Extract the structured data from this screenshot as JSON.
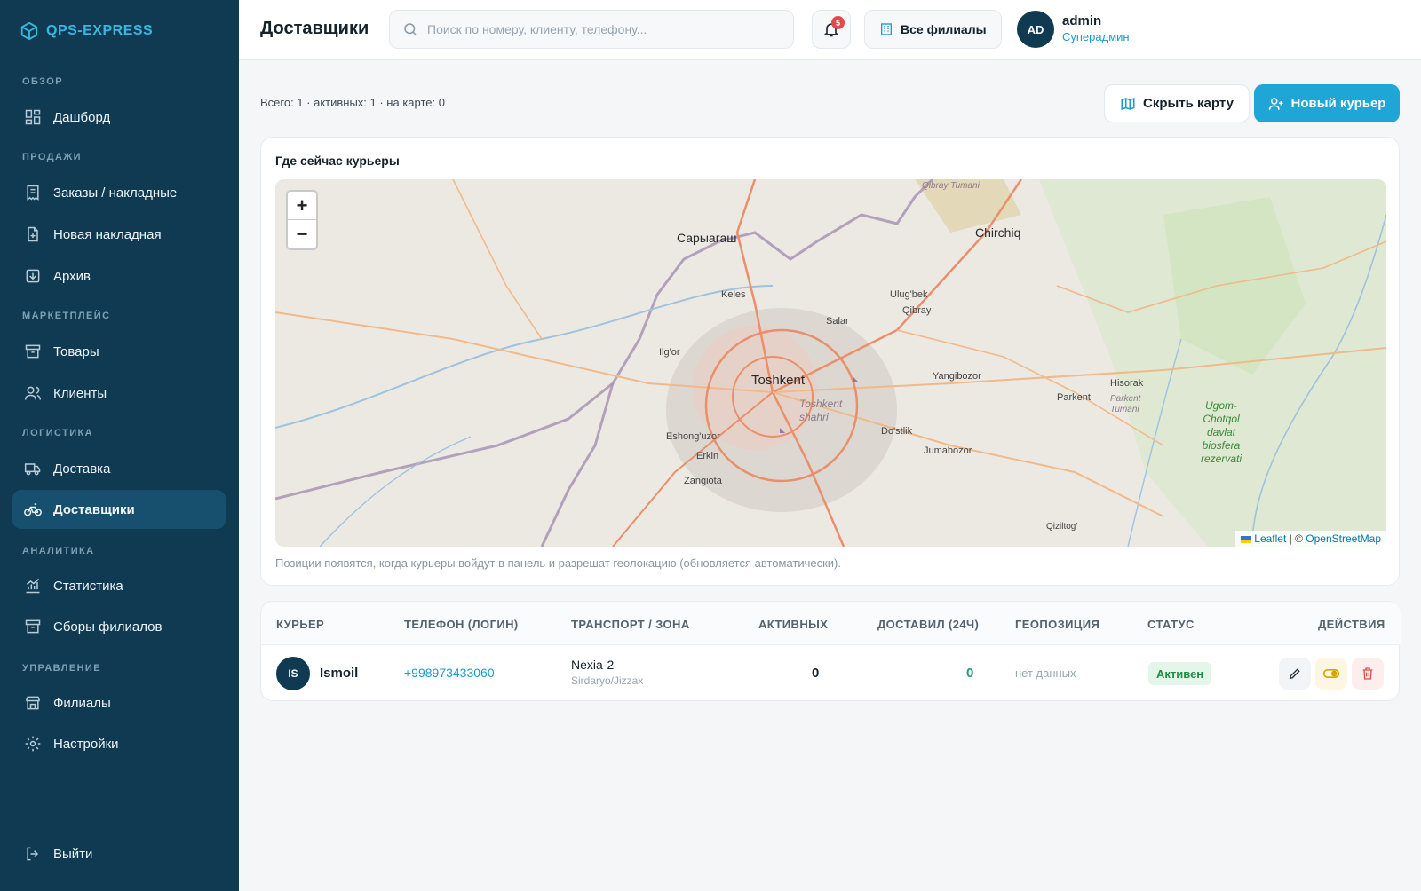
{
  "sidebar": {
    "logo_text": "QPS-EXPRESS",
    "sections": {
      "overview": "ОБЗОР",
      "sales": "ПРОДАЖИ",
      "marketplace": "МАРКЕТПЛЕЙС",
      "logistics": "ЛОГИСТИКА",
      "analytics": "АНАЛИТИКА",
      "management": "УПРАВЛЕНИЕ"
    },
    "items": {
      "dashboard": "Дашборд",
      "orders": "Заказы / накладные",
      "new_invoice": "Новая накладная",
      "archive": "Архив",
      "products": "Товары",
      "clients": "Клиенты",
      "delivery": "Доставка",
      "couriers": "Доставщики",
      "statistics": "Статистика",
      "branch_fees": "Сборы филиалов",
      "branches": "Филиалы",
      "settings": "Настройки"
    },
    "logout": "Выйти",
    "active_item": "couriers"
  },
  "header": {
    "title": "Доставщики",
    "search_placeholder": "Поиск по номеру, клиенту, телефону...",
    "notifications_count": "5",
    "branches_label": "Все филиалы",
    "user": {
      "initials": "AD",
      "name": "admin",
      "role": "Суперадмин"
    }
  },
  "toolbar": {
    "totals": "Всего: 1 · активных: 1 · на карте: 0",
    "hide_map_label": "Скрыть карту",
    "new_courier_label": "Новый курьер"
  },
  "map_card": {
    "title": "Где сейчас курьеры",
    "zoom_in": "+",
    "zoom_out": "−",
    "attribution_leaflet": "Leaflet",
    "attribution_sep": "| ©",
    "attribution_osm": "OpenStreetMap",
    "note": "Позиции появятся, когда курьеры войдут в панель и разрешат геолокацию (обновляется автоматически).",
    "labels": {
      "sariagash": "Сарыагаш",
      "chirchiq": "Chirchiq",
      "qibray_tumani": "Qibray Tumani",
      "keles": "Keles",
      "ulugbek": "Ulug'bek",
      "qibray": "Qibray",
      "salar": "Salar",
      "ilgor": "Ilg'or",
      "toshkent": "Toshkent",
      "toshkent_shahri": "Toshkent shahri",
      "yangibozor": "Yangibozor",
      "parkent": "Parkent",
      "hisorak": "Hisorak",
      "parkent_tumani": "Parkent Tumani",
      "eshonguzor": "Eshong'uzor",
      "erkin": "Erkin",
      "zangiota": "Zangiota",
      "dostlik": "Do'stlik",
      "jumabozor": "Jumabozor",
      "qiziltog": "Qiziltog'",
      "ugom": "Ugom-Chotqol davlat biosfera rezervati"
    }
  },
  "table": {
    "headers": {
      "courier": "КУРЬЕР",
      "phone": "ТЕЛЕФОН (ЛОГИН)",
      "transport": "ТРАНСПОРТ / ЗОНА",
      "active": "АКТИВНЫХ",
      "delivered": "ДОСТАВИЛ (24Ч)",
      "geo": "ГЕОПОЗИЦИЯ",
      "status": "СТАТУС",
      "actions": "ДЕЙСТВИЯ"
    },
    "rows": [
      {
        "initials": "IS",
        "name": "Ismoil",
        "phone": "+998973433060",
        "transport": "Nexia-2",
        "zone": "Sirdaryo/Jizzax",
        "active": "0",
        "delivered": "0",
        "geo": "нет данных",
        "status": "Активен"
      }
    ]
  },
  "colors": {
    "sidebar_bg": "#0f3a52",
    "accent": "#1fa5d6",
    "status_active": "#1f8c46"
  }
}
